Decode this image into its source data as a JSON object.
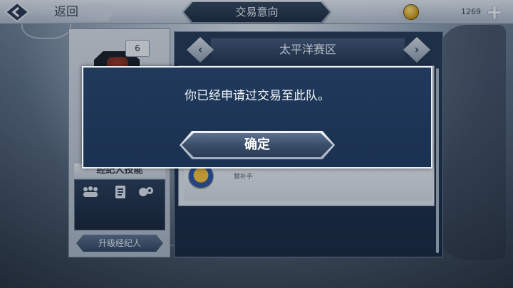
{
  "topbar": {
    "back_label": "返回",
    "title": "交易意向",
    "coins": "1269"
  },
  "left_panel": {
    "level": "6",
    "skill_header": "经纪人技能",
    "upgrade_label": "升级经纪人"
  },
  "right_panel": {
    "region": "太平洋赛区",
    "player_role": "替补",
    "player_role_suffix": "手"
  },
  "modal": {
    "message": "你已经申请过交易至此队。",
    "confirm_label": "确定"
  },
  "icons": {
    "back": "back-arrow-icon",
    "coin": "coin-icon",
    "add": "plus-icon",
    "prev": "chevron-left-icon",
    "next": "chevron-right-icon"
  }
}
